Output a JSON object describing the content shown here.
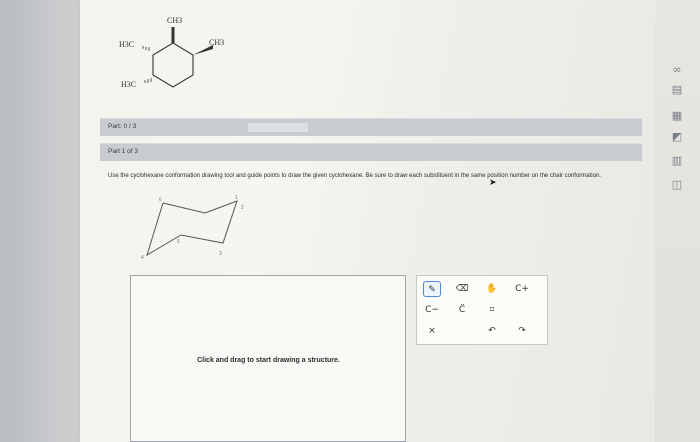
{
  "molecule": {
    "labels": [
      "CH3",
      "CH3",
      "H3C",
      "H3C"
    ]
  },
  "part_summary": {
    "label": "Part: 0 / 3",
    "progress": 0
  },
  "part_header": {
    "label": "Part 1 of 3"
  },
  "instructions": "Use the cyclohexane conformation drawing tool and guide points to draw the given cyclohexane. Be sure to draw each substituent in the same position number on the chair conformation.",
  "chair": {
    "positions": [
      "1",
      "2",
      "3",
      "4",
      "5",
      "6"
    ]
  },
  "canvas": {
    "hint": "Click and drag to start drawing a structure."
  },
  "toolbar": {
    "buttons": [
      "pencil",
      "eraser",
      "hand",
      "C+",
      "C−",
      "C̈",
      "lasso",
      "×",
      "undo",
      "redo"
    ],
    "active": "pencil"
  },
  "side_tools": [
    "infinity-icon",
    "calculator-icon",
    "periodic-table-icon",
    "reference-icon",
    "notes-icon",
    "book-icon"
  ],
  "colors": {
    "accent": "#4f86d8",
    "bar": "#c8cbcf"
  }
}
